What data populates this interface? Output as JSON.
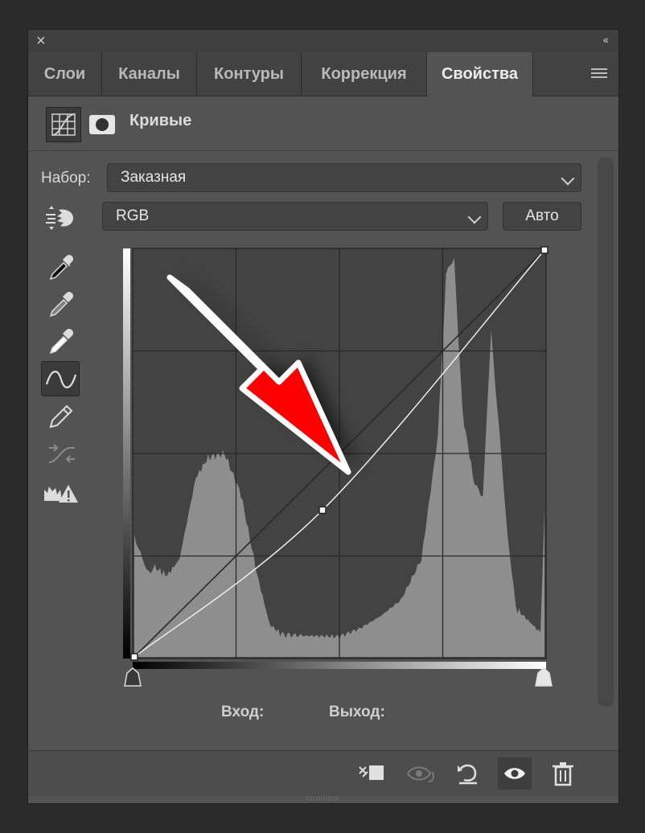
{
  "window": {
    "close_label": "×",
    "collapse_label": "‹‹"
  },
  "tabs": [
    {
      "label": "Слои"
    },
    {
      "label": "Каналы"
    },
    {
      "label": "Контуры"
    },
    {
      "label": "Коррекция"
    },
    {
      "label": "Свойства",
      "active": true
    }
  ],
  "header": {
    "title": "Кривые",
    "icons": [
      "curves-adjustment-icon",
      "layer-mask-icon"
    ]
  },
  "preset": {
    "label": "Набор:",
    "value": "Заказная"
  },
  "channel": {
    "value": "RGB"
  },
  "auto_button": {
    "label": "Авто"
  },
  "tools": [
    "on-image-adjust-icon",
    "black-point-eyedropper-icon",
    "gray-point-eyedropper-icon",
    "white-point-eyedropper-icon",
    "curve-points-icon",
    "pencil-icon",
    "smooth-icon",
    "clipping-warning-icon"
  ],
  "selected_tool": "curve-points-icon",
  "curve": {
    "points": [
      [
        0,
        0
      ],
      [
        117,
        92
      ],
      [
        255,
        255
      ]
    ],
    "range": [
      0,
      255
    ]
  },
  "io": {
    "input_label": "Вход:",
    "output_label": "Выход:"
  },
  "footer_icons": [
    "clip-to-layer-icon",
    "view-previous-state-icon",
    "reset-icon",
    "visibility-eye-icon",
    "trash-icon"
  ],
  "annotation": {
    "arrow_color": "#ff0000",
    "arrow_outline": "#ffffff"
  }
}
